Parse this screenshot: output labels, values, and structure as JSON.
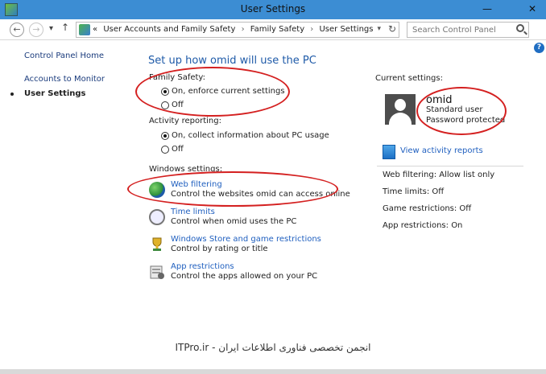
{
  "window": {
    "title": "User Settings",
    "minimize": "—",
    "close": "✕"
  },
  "address": {
    "breadcrumbs": [
      "User Accounts and Family Safety",
      "Family Safety",
      "User Settings"
    ],
    "overflow": "«",
    "search_placeholder": "Search Control Panel"
  },
  "help": "?",
  "sidebar": {
    "items": [
      {
        "label": "Control Panel Home"
      },
      {
        "label": "Accounts to Monitor"
      },
      {
        "label": "User Settings"
      }
    ]
  },
  "main": {
    "heading": "Set up how omid will use the PC",
    "family_safety": {
      "label": "Family Safety:",
      "options": [
        "On, enforce current settings",
        "Off"
      ],
      "selected": 0
    },
    "activity_reporting": {
      "label": "Activity reporting:",
      "options": [
        "On, collect information about PC usage",
        "Off"
      ],
      "selected": 0
    },
    "windows_settings": {
      "label": "Windows settings:",
      "items": [
        {
          "title": "Web filtering",
          "desc": "Control the websites omid can access online",
          "icon": "globe-icon"
        },
        {
          "title": "Time limits",
          "desc": "Control when omid uses the PC",
          "icon": "stopwatch-icon"
        },
        {
          "title": "Windows Store and game restrictions",
          "desc": "Control by rating or title",
          "icon": "trophy-icon"
        },
        {
          "title": "App restrictions",
          "desc": "Control the apps allowed on your PC",
          "icon": "app-restrictions-icon"
        }
      ]
    }
  },
  "current": {
    "label": "Current settings:",
    "user": {
      "name": "omid",
      "type": "Standard user",
      "password": "Password protected"
    },
    "view_reports": "View activity reports",
    "summary": [
      "Web filtering: Allow list only",
      "Time limits: Off",
      "Game restrictions: Off",
      "App restrictions: On"
    ]
  },
  "footer": "ITPro.ir - انجمن تخصصی فناوری اطلاعات ایران",
  "colors": {
    "titlebar": "#3c8dd3",
    "link": "#1f5fbf",
    "heading": "#1e5aa8",
    "annotation": "#d42020"
  }
}
